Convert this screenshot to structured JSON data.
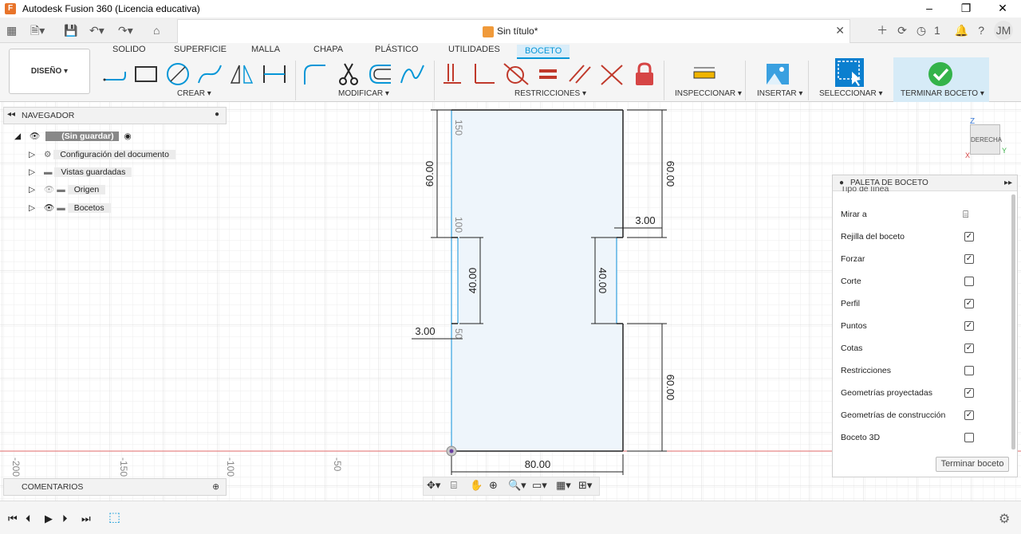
{
  "window": {
    "title": "Autodesk Fusion 360 (Licencia educativa)",
    "controls": [
      "–",
      "❐",
      "✕"
    ]
  },
  "document": {
    "title": "Sin título*"
  },
  "account": {
    "initials": "JM",
    "job_count": "1"
  },
  "ribbon": {
    "tabs": [
      "SOLIDO",
      "SUPERFICIE",
      "MALLA",
      "CHAPA",
      "PLÁSTICO",
      "UTILIDADES",
      "BOCETO"
    ],
    "workspace": "DISEÑO ▾",
    "groups": {
      "crear": "CREAR ▾",
      "modificar": "MODIFICAR ▾",
      "restricciones": "RESTRICCIONES ▾",
      "inspeccionar": "INSPECCIONAR ▾",
      "insertar": "INSERTAR ▾",
      "seleccionar": "SELECCIONAR ▾",
      "terminar": "TERMINAR BOCETO ▾"
    }
  },
  "browser": {
    "title": "NAVEGADOR",
    "root": "(Sin guardar)",
    "items": [
      "Configuración del documento",
      "Vistas guardadas",
      "Origen",
      "Bocetos"
    ]
  },
  "comments": {
    "title": "COMENTARIOS"
  },
  "palette": {
    "title": "PALETA DE BOCETO",
    "partial_top": "Tipo de línea",
    "rows": [
      {
        "label": "Mirar a",
        "checked": null
      },
      {
        "label": "Rejilla del boceto",
        "checked": true
      },
      {
        "label": "Forzar",
        "checked": true
      },
      {
        "label": "Corte",
        "checked": false
      },
      {
        "label": "Perfil",
        "checked": true
      },
      {
        "label": "Puntos",
        "checked": true
      },
      {
        "label": "Cotas",
        "checked": true
      },
      {
        "label": "Restricciones",
        "checked": false
      },
      {
        "label": "Geometrías proyectadas",
        "checked": true
      },
      {
        "label": "Geometrías de construcción",
        "checked": true
      },
      {
        "label": "Boceto 3D",
        "checked": false
      }
    ],
    "finish_button": "Terminar boceto"
  },
  "sketch": {
    "dim_top_left": "60.00",
    "dim_top_right": "60.00",
    "dim_notch_left": "40.00",
    "dim_notch_right": "40.00",
    "dim_bottom_right": "60.00",
    "dim_width": "80.00",
    "dim_depth_left": "3.00",
    "dim_depth_right": "3.00",
    "ruler_v": [
      "150",
      "100",
      "50"
    ],
    "ruler_h": [
      "-200",
      "-150",
      "-100",
      "-50"
    ]
  },
  "viewcube": {
    "face": "DERECHA",
    "axis_z": "Z",
    "axis_y": "Y",
    "axis_x": "X"
  },
  "colors": {
    "accent": "#0696d7",
    "sketch_fill": "#eef5fb",
    "axis_red": "#e26a6a",
    "finish_green": "#34b34a"
  }
}
